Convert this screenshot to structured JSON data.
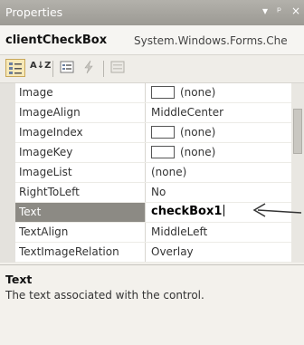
{
  "window": {
    "title": "Properties",
    "buttons": [
      "▾",
      "ᵖ",
      "×"
    ]
  },
  "object": {
    "name": "clientCheckBox",
    "type": "System.Windows.Forms.Che"
  },
  "toolbar": {
    "icons": [
      "categorized-icon",
      "alphabetical-icon",
      "properties-icon",
      "events-icon",
      "property-pages-icon"
    ],
    "alphabetical_label": "A↓Z"
  },
  "properties": [
    {
      "name": "Image",
      "value": "(none)"
    },
    {
      "name": "ImageAlign",
      "value": "MiddleCenter"
    },
    {
      "name": "ImageIndex",
      "value": "(none)"
    },
    {
      "name": "ImageKey",
      "value": "(none)"
    },
    {
      "name": "ImageList",
      "value": "(none)"
    },
    {
      "name": "RightToLeft",
      "value": "No"
    },
    {
      "name": "Text",
      "value": "checkBox1"
    },
    {
      "name": "TextAlign",
      "value": "MiddleLeft"
    },
    {
      "name": "TextImageRelation",
      "value": "Overlay"
    }
  ],
  "description": {
    "title": "Text",
    "text": "The text associated with the control."
  },
  "colors": {
    "titlebar": "#a8a6a0",
    "selected_row": "#8c8a84",
    "background": "#f3f1ec"
  }
}
